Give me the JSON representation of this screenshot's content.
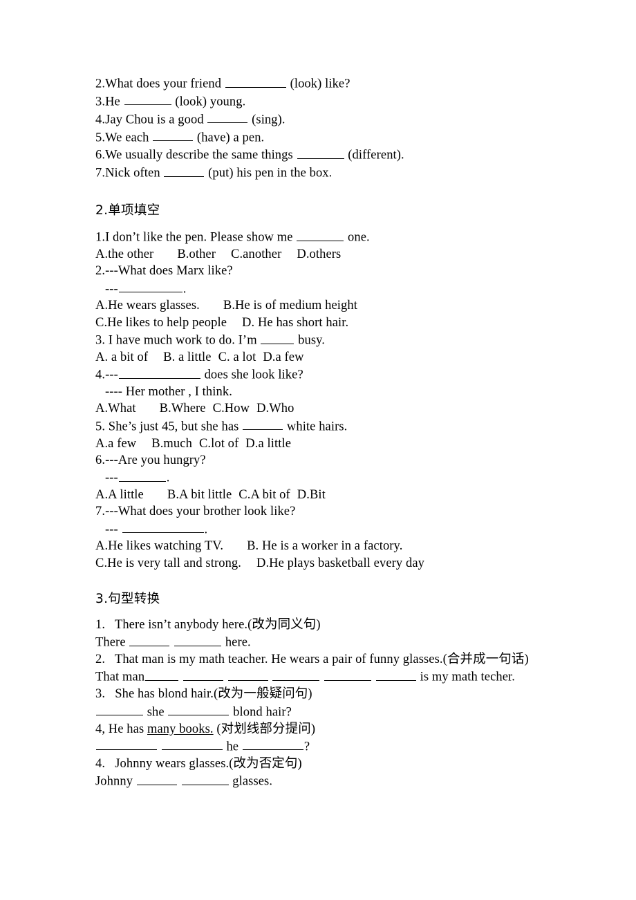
{
  "document": {
    "title": "English Exercise Worksheet",
    "background_color": "#ffffff",
    "text_color": "#000000"
  },
  "section1": {
    "items": [
      {
        "number": "2.",
        "pre": "What does your friend ",
        "post": " (look) like?"
      },
      {
        "number": "3.",
        "pre": "He ",
        "post": " (look) young."
      },
      {
        "number": "4.",
        "pre": "Jay Chou is a good ",
        "post": " (sing)."
      },
      {
        "number": "5.",
        "pre": "We each ",
        "post": " (have) a pen."
      },
      {
        "number": "6.",
        "pre": "We usually describe the same things ",
        "post": " (different)."
      },
      {
        "number": "7.",
        "pre": "Nick often ",
        "post": " (put) his pen in the box."
      }
    ]
  },
  "section2": {
    "heading": "2.单项填空",
    "q1": {
      "stem_pre": "1.I don’t like the pen. Please show me ",
      "stem_post": " one.",
      "options": [
        "A.the other",
        "B.other",
        "C.another",
        "D.others"
      ]
    },
    "q2": {
      "stem": "2.---What does Marx like?",
      "answer_prefix": "---",
      "answer_suffix": ".",
      "options_line1": [
        "A.He wears glasses.",
        "B.He is of medium height"
      ],
      "options_line2": [
        "C.He likes to help people",
        "D. He has short hair."
      ]
    },
    "q3": {
      "stem_pre": "3. I have much work to do. I’m ",
      "stem_post": " busy.",
      "options": [
        "A. a bit of",
        "B. a little",
        "C. a lot",
        "D.a few"
      ]
    },
    "q4": {
      "stem_pre": "4.---",
      "stem_post": " does she look like?",
      "answer": "---- Her mother , I think.",
      "options": [
        "A.What",
        "B.Where",
        "C.How",
        "D.Who"
      ]
    },
    "q5": {
      "stem_pre": "5. She’s just 45, but she has ",
      "stem_post": " white hairs.",
      "options": [
        "A.a few",
        "B.much",
        "C.lot of",
        "D.a little"
      ]
    },
    "q6": {
      "stem": "6.---Are you hungry?",
      "answer_prefix": "---",
      "answer_suffix": ".",
      "options": [
        "A.A little",
        "B.A bit little",
        "C.A bit of",
        "D.Bit"
      ]
    },
    "q7": {
      "stem": "7.---What does your brother look like?",
      "answer_prefix": "---",
      "answer_suffix": ".",
      "options_line1": [
        "A.He likes watching TV.",
        "B. He is a worker in a factory."
      ],
      "options_line2": [
        "C.He is very tall and strong.",
        "D.He plays basketball every day"
      ]
    }
  },
  "section3": {
    "heading": "3.句型转换",
    "q1": {
      "stem": "1.   There isn’t anybody here.(改为同义句)",
      "answer_pre": "There ",
      "answer_post": " here."
    },
    "q2": {
      "stem": "2.   That man is my math teacher. He wears a pair of funny glasses.(合并成一句话)",
      "answer_pre": "That man",
      "answer_post": " is my math techer."
    },
    "q3": {
      "stem": "3.   She has blond hair.(改为一般疑问句)",
      "answer_mid": " she ",
      "answer_post": " blond hair?"
    },
    "q4": {
      "stem_pre": "4, He has ",
      "stem_underlined": "many books.",
      "stem_post": " (对划线部分提问)",
      "answer_mid": " he ",
      "answer_post": "?"
    },
    "q5": {
      "stem": "4.   Johnny wears glasses.(改为否定句)",
      "answer_pre": "Johnny ",
      "answer_post": " glasses."
    }
  }
}
